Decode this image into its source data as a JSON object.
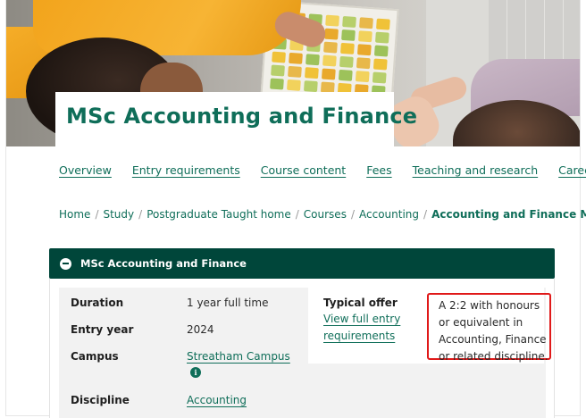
{
  "page": {
    "title": "MSc Accounting and Finance",
    "accent_color": "#0f6e59",
    "header_bar_color": "#00463a",
    "highlight_color": "#e01919"
  },
  "tabs": [
    {
      "label": "Overview"
    },
    {
      "label": "Entry requirements"
    },
    {
      "label": "Course content"
    },
    {
      "label": "Fees"
    },
    {
      "label": "Teaching and research"
    },
    {
      "label": "Careers"
    }
  ],
  "breadcrumb": [
    {
      "label": "Home"
    },
    {
      "label": "Study"
    },
    {
      "label": "Postgraduate Taught home"
    },
    {
      "label": "Courses"
    },
    {
      "label": "Accounting"
    },
    {
      "label": "Accounting and Finance MSc"
    }
  ],
  "breadcrumb_separator": "/",
  "accordion": {
    "title": "MSc Accounting and Finance",
    "icon": "minus-circle-icon",
    "expanded": true
  },
  "details": {
    "duration_label": "Duration",
    "duration_value": "1 year full time",
    "entry_year_label": "Entry year",
    "entry_year_value": "2024",
    "campus_label": "Campus",
    "campus_value": "Streatham Campus",
    "campus_info_icon": "info-icon",
    "discipline_label": "Discipline",
    "discipline_value": "Accounting",
    "typical_offer_label": "Typical offer",
    "view_link_line1": "View full entry",
    "view_link_line2": "requirements",
    "offer_lines": [
      "A 2:2 with honours",
      "or equivalent in",
      "Accounting, Finance",
      "or related discipline."
    ]
  }
}
